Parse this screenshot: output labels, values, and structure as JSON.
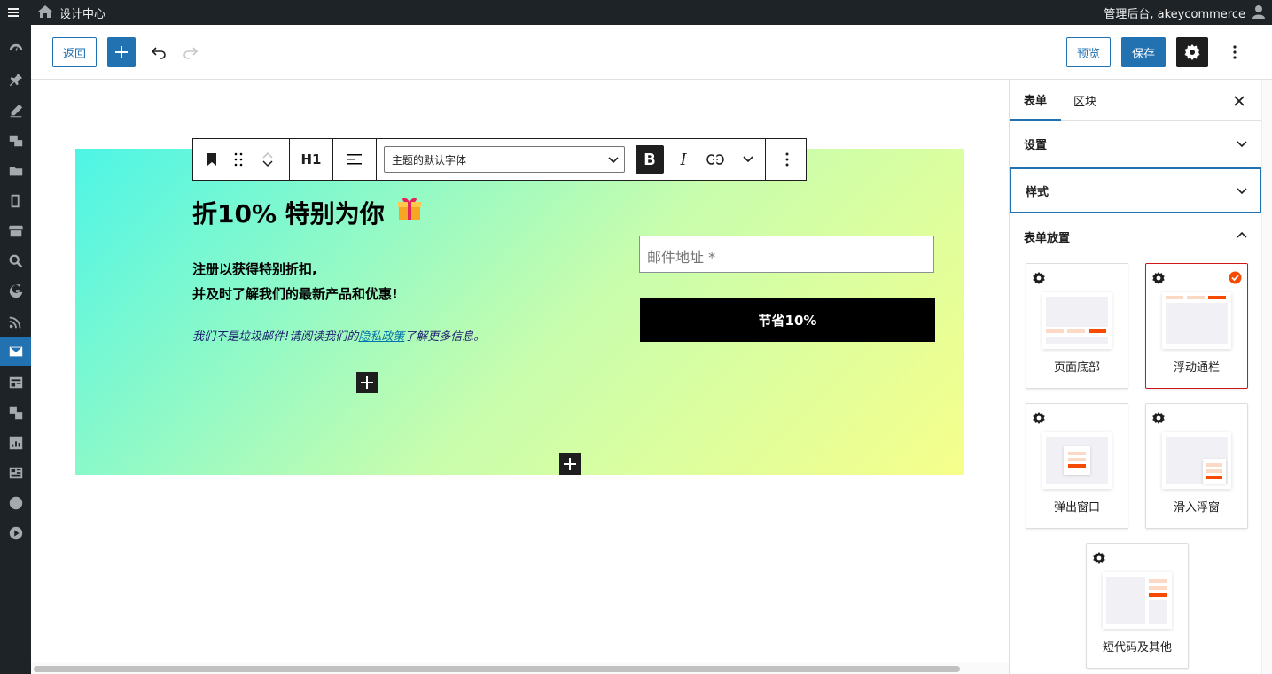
{
  "adminbar": {
    "site_title": "设计中心",
    "account": "管理后台, akeycommerce"
  },
  "toolbar": {
    "back_label": "返回",
    "preview_label": "预览",
    "save_label": "保存"
  },
  "block_toolbar": {
    "heading_level": "H1",
    "font_select": "主题的默认字体",
    "bold": "B",
    "italic": "I"
  },
  "form": {
    "heading": "折10% 特别为你",
    "para_line1": "注册以获得特别折扣,",
    "para_line2": "并及时了解我们的最新产品和优惠!",
    "note_prefix": "我们不是垃圾邮件!请阅读我们的",
    "note_link": "隐私政策",
    "note_suffix": "了解更多信息。",
    "email_placeholder": "邮件地址 *",
    "submit_label": "节省10%"
  },
  "sidebar": {
    "tabs": [
      "表单",
      "区块"
    ],
    "panels": {
      "settings": "设置",
      "styles": "样式",
      "placement": "表单放置"
    },
    "placements": [
      {
        "label": "页面底部",
        "selected": false
      },
      {
        "label": "浮动通栏",
        "selected": true
      },
      {
        "label": "弹出窗口",
        "selected": false
      },
      {
        "label": "滑入浮窗",
        "selected": false
      },
      {
        "label": "短代码及其他",
        "selected": false
      }
    ]
  },
  "colors": {
    "accent": "#2271b1",
    "admin_dark": "#1d2327",
    "selected_border": "#cc1818",
    "placement_orange": "#f54a00",
    "placement_peach": "#fcd9c4"
  }
}
